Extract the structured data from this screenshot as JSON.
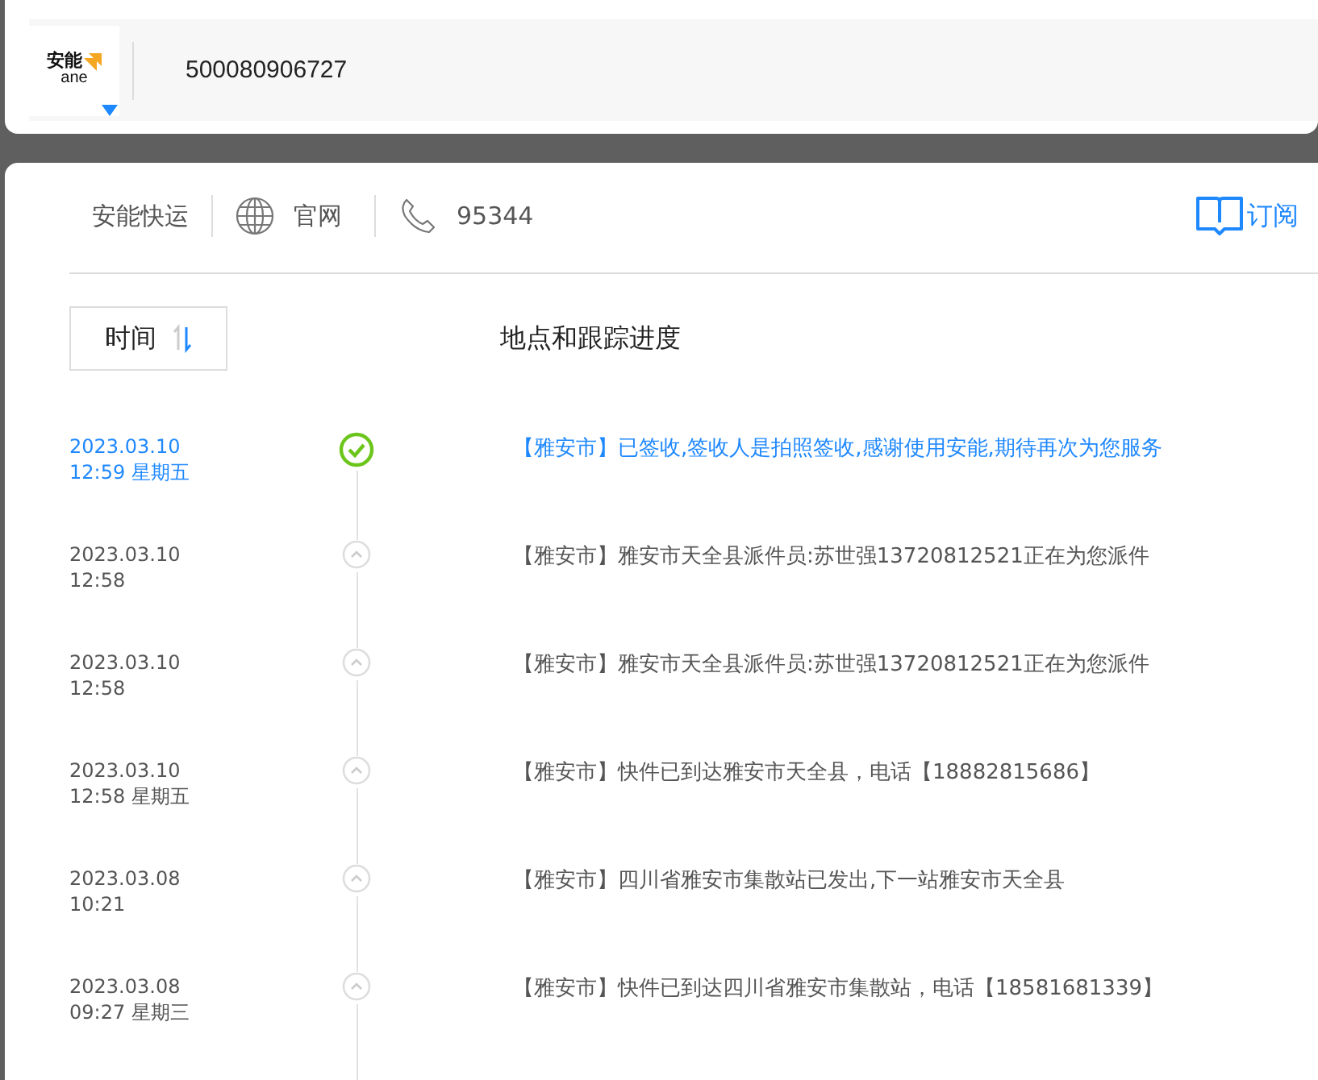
{
  "logo": {
    "text": "安能",
    "subtext": "ane"
  },
  "search": {
    "value": "500080906727"
  },
  "carrier": {
    "name": "安能快运",
    "website": "官网",
    "phone": "95344",
    "subscribe": "订阅"
  },
  "sort_button": {
    "label": "时间"
  },
  "column_header": "地点和跟踪进度",
  "events": [
    {
      "date": "2023.03.10",
      "time": "12:59 星期五",
      "text": "【雅安市】已签收,签收人是拍照签收,感谢使用安能,期待再次为您服务",
      "current": true
    },
    {
      "date": "2023.03.10",
      "time": "12:58",
      "text": "【雅安市】雅安市天全县派件员:苏世强13720812521正在为您派件",
      "current": false
    },
    {
      "date": "2023.03.10",
      "time": "12:58",
      "text": "【雅安市】雅安市天全县派件员:苏世强13720812521正在为您派件",
      "current": false
    },
    {
      "date": "2023.03.10",
      "time": "12:58 星期五",
      "text": "【雅安市】快件已到达雅安市天全县，电话【18882815686】",
      "current": false
    },
    {
      "date": "2023.03.08",
      "time": "10:21",
      "text": "【雅安市】四川省雅安市集散站已发出,下一站雅安市天全县",
      "current": false
    },
    {
      "date": "2023.03.08",
      "time": "09:27 星期三",
      "text": "【雅安市】快件已到达四川省雅安市集散站，电话【18581681339】",
      "current": false
    }
  ]
}
